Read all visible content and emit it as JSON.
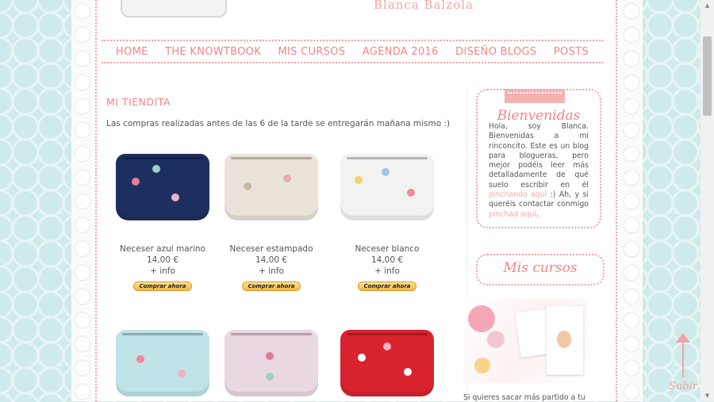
{
  "header": {
    "site_name": "Blanca Balzola"
  },
  "nav": {
    "items": [
      "HOME",
      "THE KNOWTBOOK",
      "MIS CURSOS",
      "AGENDA 2016",
      "DISEÑO BLOGS",
      "POSTS"
    ]
  },
  "main": {
    "title": "MI TIENDITA",
    "notice": "Las compras realizadas antes de las 6 de la tarde se entregarán mañana mismo :)",
    "buy_label": "Comprar ahora",
    "products": [
      {
        "name": "Neceser azul marino",
        "price": "14,00 €",
        "info": "+ info",
        "color": "#1d2f5e"
      },
      {
        "name": "Neceser estampado",
        "price": "14,00 €",
        "info": "+ info",
        "color": "#e9e3da"
      },
      {
        "name": "Neceser blanco",
        "price": "14,00 €",
        "info": "+ info",
        "color": "#f2f2f0"
      },
      {
        "name": "",
        "price": "",
        "info": "",
        "color": "#bfe3e6"
      },
      {
        "name": "",
        "price": "",
        "info": "",
        "color": "#ead7e4"
      },
      {
        "name": "",
        "price": "",
        "info": "",
        "color": "#d8232f"
      }
    ]
  },
  "sidebar": {
    "welcome_title": "Bienvenidas",
    "welcome_text_1": "Hola, soy Blanca. Bienvenidas a mi rinconcito. Este es un blog para blogueras, pero mejor podéis leer más detalladamente de qué suelo escribir en él ",
    "welcome_link_1": "pinchando aquí",
    "welcome_text_2": " :) Ah, y si queréis contactar conmigo ",
    "welcome_link_2": "pinchad aquí",
    "welcome_text_3": ".",
    "courses_title": "Mis cursos",
    "bottom_text": "Si quieres sacar más partido a tu"
  },
  "back_to_top": {
    "label": "Subir"
  },
  "colors": {
    "accent": "#f08585",
    "dotted": "#f1a3a3",
    "background": "#cfeaea"
  }
}
